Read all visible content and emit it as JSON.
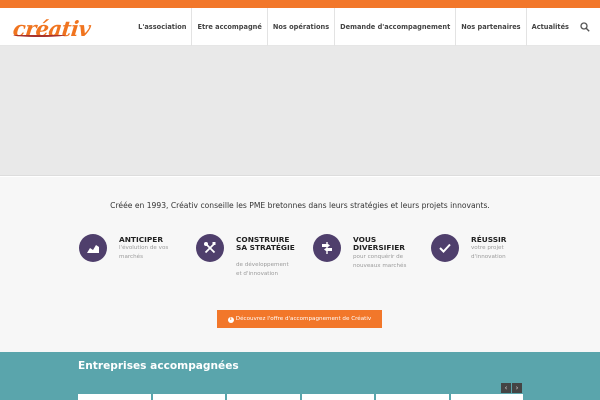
{
  "brand": {
    "logo_text": "créativ",
    "accent_color": "#f2772a",
    "dark_color": "#4f3f6c",
    "teal_color": "#5aa5ac"
  },
  "nav": {
    "items": [
      {
        "label": "L'association"
      },
      {
        "label": "Etre accompagné"
      },
      {
        "label": "Nos opérations"
      },
      {
        "label": "Demande d'accompagnement"
      },
      {
        "label": "Nos partenaires"
      },
      {
        "label": "Actualités"
      }
    ],
    "search_icon": "search-icon"
  },
  "intro": {
    "text": "Créée en 1993, Créativ conseille les PME bretonnes dans leurs stratégies et leurs projets innovants."
  },
  "features": [
    {
      "title": "ANTICIPER",
      "desc": "l'évolution de vos marchés",
      "icon": "chart-icon"
    },
    {
      "title": "CONSTRUIRE SA STRATÉGIE",
      "desc": "de développement et d'innovation",
      "icon": "tools-icon"
    },
    {
      "title": "VOUS DIVERSIFIER",
      "desc": "pour conquérir de nouveaux marchés",
      "icon": "signpost-icon"
    },
    {
      "title": "RÉUSSIR",
      "desc": "votre projet d'innovation",
      "icon": "check-icon"
    }
  ],
  "cta": {
    "label": "Découvrez l'offre d'accompagnement de Créativ",
    "icon": "info-icon"
  },
  "companies": {
    "title": "Entreprises accompagnées",
    "prev_label": "‹",
    "next_label": "›"
  }
}
